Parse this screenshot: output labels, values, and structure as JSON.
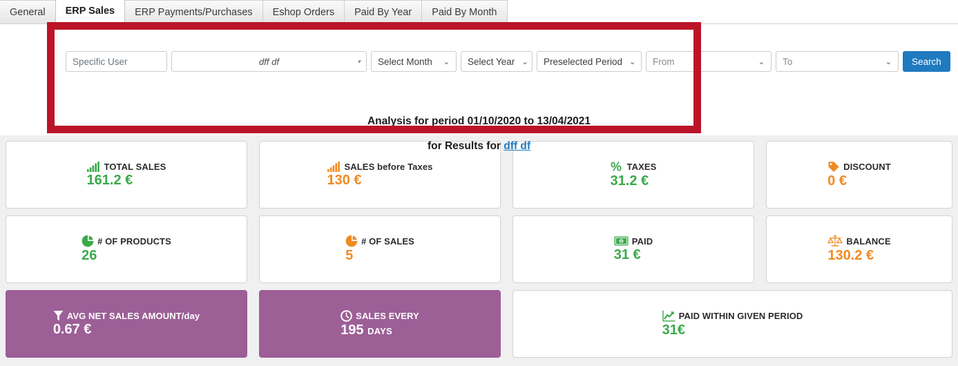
{
  "tabs": [
    {
      "label": "General",
      "active": false
    },
    {
      "label": "ERP Sales",
      "active": true
    },
    {
      "label": "ERP Payments/Purchases",
      "active": false
    },
    {
      "label": "Eshop Orders",
      "active": false
    },
    {
      "label": "Paid By Year",
      "active": false
    },
    {
      "label": "Paid By Month",
      "active": false
    }
  ],
  "filters": {
    "specific_user_label": "Specific User",
    "user_select_value": "dff df",
    "month_select": "Select Month",
    "year_select": "Select Year",
    "period_select": "Preselected Period",
    "from_placeholder": "From",
    "to_placeholder": "To",
    "search_label": "Search",
    "caret": "⌄",
    "caret_small": "▾"
  },
  "summary": {
    "analysis_text": "Analysis for period 01/10/2020 to 13/04/2021",
    "results_prefix": "for Results for ",
    "results_link": "dff df"
  },
  "colors": {
    "green": "#3aaa49",
    "orange": "#f08a22",
    "purple": "#9c5f96",
    "accent_blue": "#1f7ac0",
    "annotation_red": "#bb1428"
  },
  "cards": {
    "row1": [
      {
        "icon": "bar-chart-icon",
        "label": "TOTAL SALES",
        "value": "161.2 €",
        "color": "green"
      },
      {
        "icon": "bar-chart-icon",
        "label": "SALES before Taxes",
        "value": "130 €",
        "color": "orange"
      },
      {
        "icon": "percent-icon",
        "label": "TAXES",
        "value": "31.2 €",
        "color": "green"
      },
      {
        "icon": "tag-icon",
        "label": "DISCOUNT",
        "value": "0 €",
        "color": "orange"
      }
    ],
    "row2": [
      {
        "icon": "pie-chart-icon",
        "label": "# OF PRODUCTS",
        "value": "26",
        "color": "green"
      },
      {
        "icon": "pie-chart-icon",
        "label": "# OF SALES",
        "value": "5",
        "color": "orange"
      },
      {
        "icon": "banknote-icon",
        "label": "PAID",
        "value": "31 €",
        "color": "green"
      },
      {
        "icon": "scales-icon",
        "label": "BALANCE",
        "value": "130.2 €",
        "color": "orange"
      }
    ],
    "row3": [
      {
        "icon": "funnel-icon",
        "label": "AVG NET SALES AMOUNT/day",
        "value": "0.67 €",
        "unit": "",
        "color": "white"
      },
      {
        "icon": "clock-icon",
        "label": "SALES EVERY",
        "value": "195",
        "unit": "DAYS",
        "color": "white"
      },
      {
        "icon": "trend-up-icon",
        "label": "PAID WITHIN GIVEN PERIOD",
        "value": "31€",
        "unit": "",
        "color": "green"
      }
    ]
  }
}
